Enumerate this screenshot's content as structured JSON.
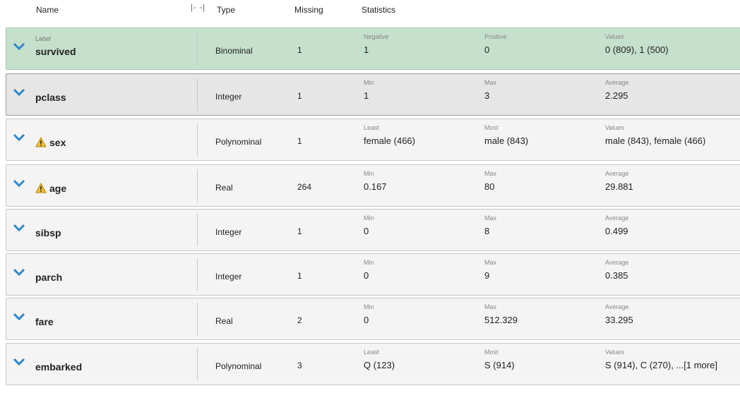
{
  "header": {
    "name": "Name",
    "type": "Type",
    "missing": "Missing",
    "statistics": "Statistics",
    "resize_glyph": "|- -|"
  },
  "colors": {
    "label_row_bg": "#c5e0cd",
    "selected_row_bg": "#e6e6e6",
    "row_bg": "#f4f4f4",
    "chevron": "#2f87c9",
    "warning": "#f2c12e"
  },
  "rows": [
    {
      "role": "Label",
      "name": "survived",
      "type": "Binominal",
      "missing": "1",
      "warning": false,
      "stats": [
        {
          "label": "Negative",
          "value": "1"
        },
        {
          "label": "Positive",
          "value": "0"
        },
        {
          "label": "Values",
          "value": "0 (809), 1 (500)"
        }
      ]
    },
    {
      "role": "",
      "name": "pclass",
      "type": "Integer",
      "missing": "1",
      "warning": false,
      "stats": [
        {
          "label": "Min",
          "value": "1"
        },
        {
          "label": "Max",
          "value": "3"
        },
        {
          "label": "Average",
          "value": "2.295"
        }
      ]
    },
    {
      "role": "",
      "name": "sex",
      "type": "Polynominal",
      "missing": "1",
      "warning": true,
      "stats": [
        {
          "label": "Least",
          "value": "female (466)"
        },
        {
          "label": "Most",
          "value": "male (843)"
        },
        {
          "label": "Values",
          "value": "male (843), female (466)"
        }
      ]
    },
    {
      "role": "",
      "name": "age",
      "type": "Real",
      "missing": "264",
      "warning": true,
      "stats": [
        {
          "label": "Min",
          "value": "0.167"
        },
        {
          "label": "Max",
          "value": "80"
        },
        {
          "label": "Average",
          "value": "29.881"
        }
      ]
    },
    {
      "role": "",
      "name": "sibsp",
      "type": "Integer",
      "missing": "1",
      "warning": false,
      "stats": [
        {
          "label": "Min",
          "value": "0"
        },
        {
          "label": "Max",
          "value": "8"
        },
        {
          "label": "Average",
          "value": "0.499"
        }
      ]
    },
    {
      "role": "",
      "name": "parch",
      "type": "Integer",
      "missing": "1",
      "warning": false,
      "stats": [
        {
          "label": "Min",
          "value": "0"
        },
        {
          "label": "Max",
          "value": "9"
        },
        {
          "label": "Average",
          "value": "0.385"
        }
      ]
    },
    {
      "role": "",
      "name": "fare",
      "type": "Real",
      "missing": "2",
      "warning": false,
      "stats": [
        {
          "label": "Min",
          "value": "0"
        },
        {
          "label": "Max",
          "value": "512.329"
        },
        {
          "label": "Average",
          "value": "33.295"
        }
      ]
    },
    {
      "role": "",
      "name": "embarked",
      "type": "Polynominal",
      "missing": "3",
      "warning": false,
      "stats": [
        {
          "label": "Least",
          "value": "Q (123)"
        },
        {
          "label": "Most",
          "value": "S (914)"
        },
        {
          "label": "Values",
          "value": "S (914), C (270), ...[1 more]"
        }
      ]
    }
  ]
}
